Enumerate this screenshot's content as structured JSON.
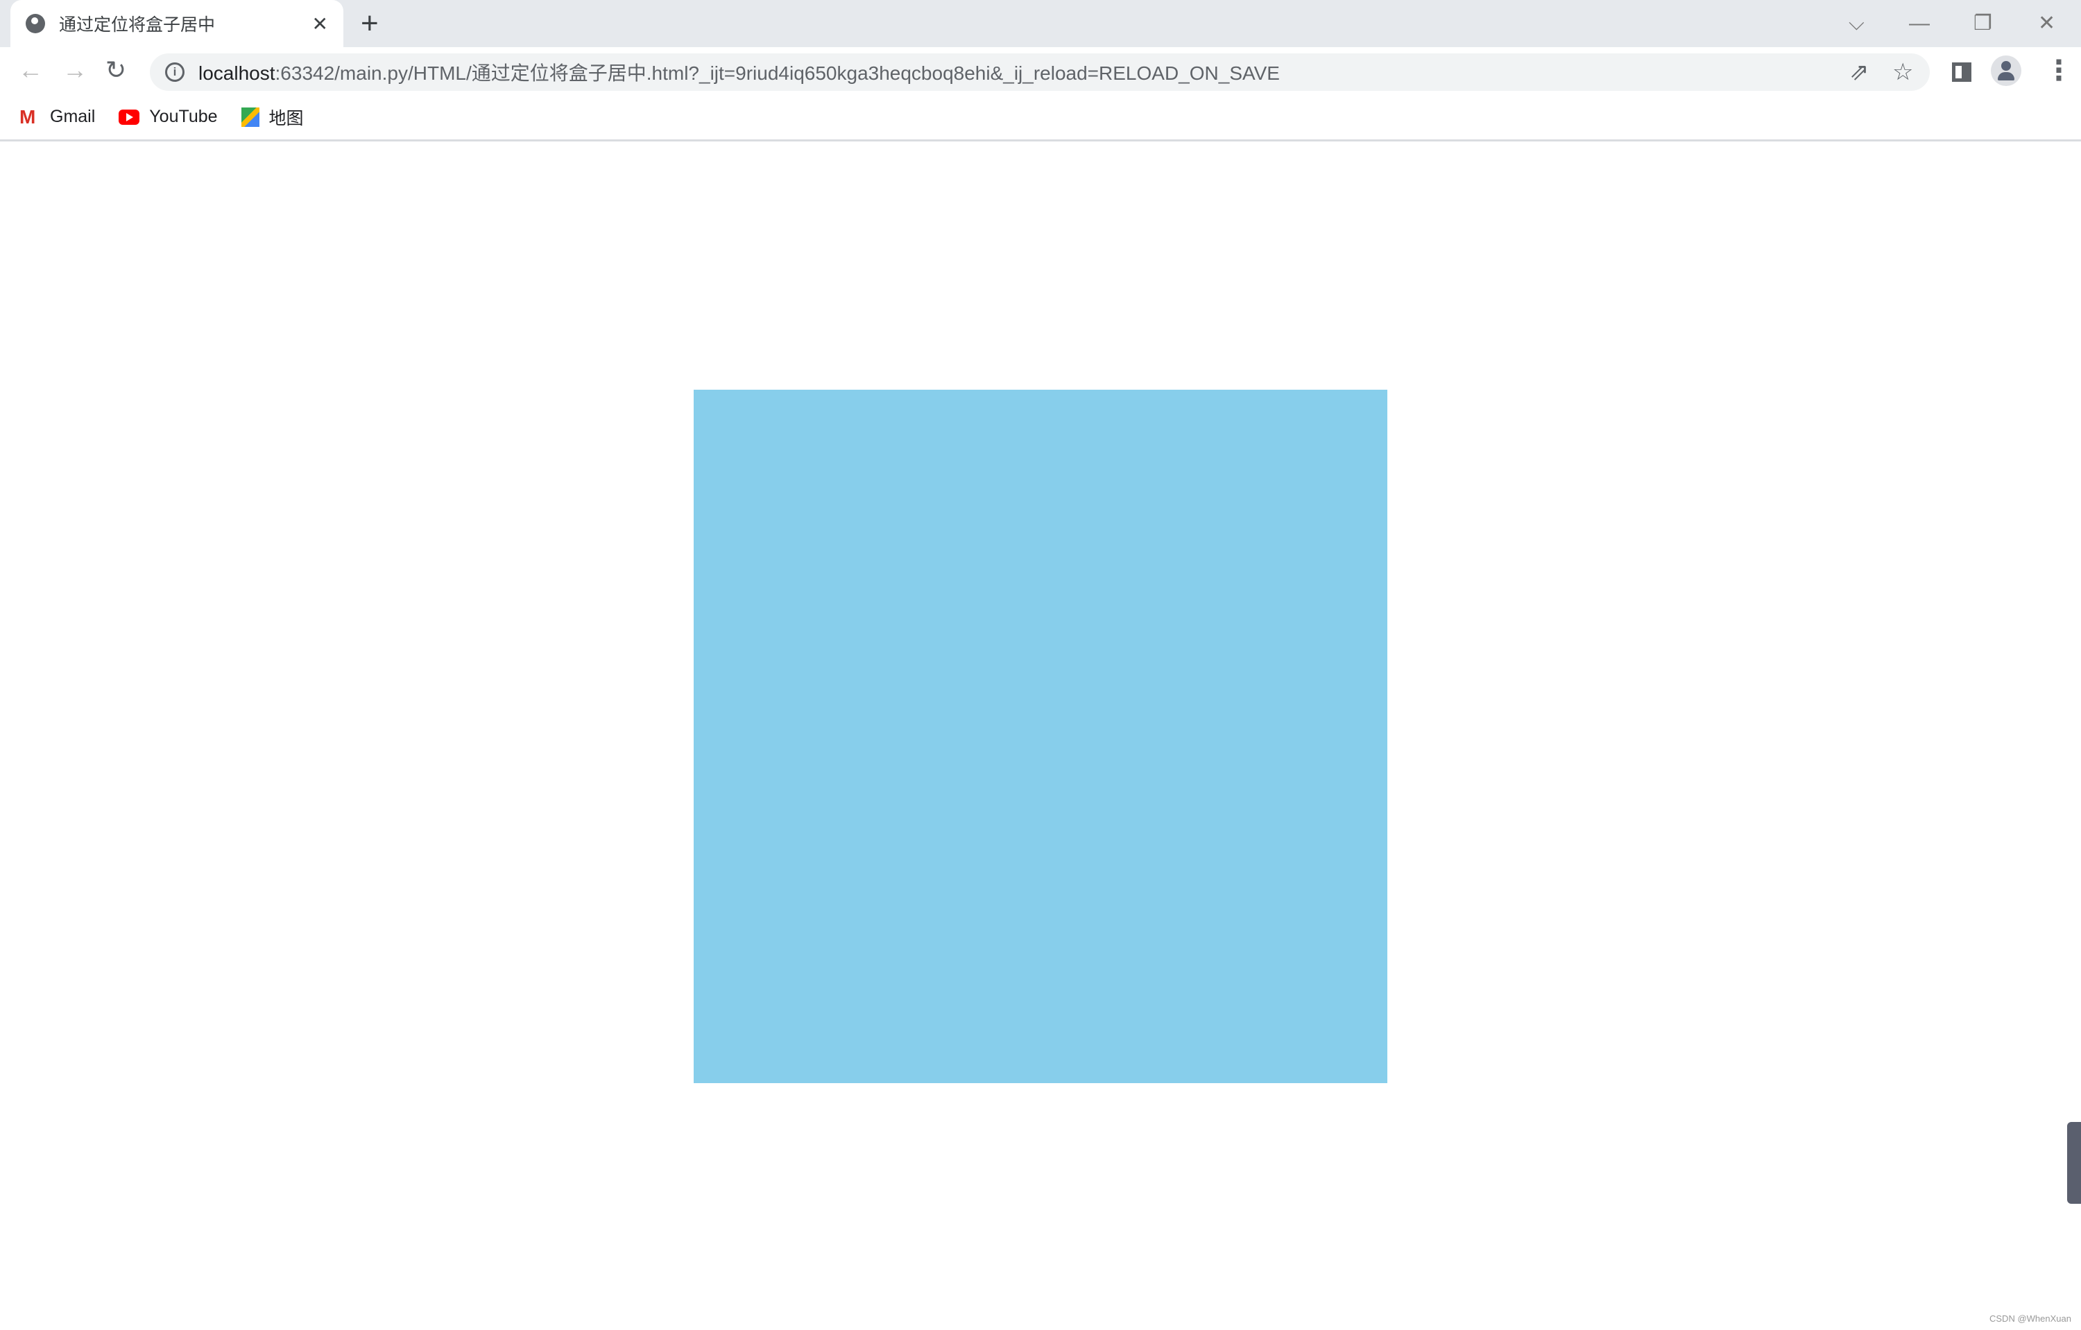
{
  "tab": {
    "title": "通过定位将盒子居中",
    "close": "✕",
    "new_tab": "+",
    "favicon": "globe-icon"
  },
  "window_controls": {
    "list": "⌵",
    "minimize": "—",
    "restore": "❐",
    "close": "✕"
  },
  "toolbar": {
    "back": "←",
    "forward": "→",
    "reload": "↻",
    "url_host": "localhost",
    "url_rest": ":63342/main.py/HTML/通过定位将盒子居中.html?_ijt=9riud4iq650kga3heqcboq8ehi&_ij_reload=RELOAD_ON_SAVE",
    "info": "i",
    "share": "⇗",
    "star": "☆",
    "menu": "⋮"
  },
  "bookmarks": [
    {
      "label": "Gmail",
      "icon": "gmail-icon"
    },
    {
      "label": "YouTube",
      "icon": "youtube-icon"
    },
    {
      "label": "地图",
      "icon": "maps-icon"
    }
  ],
  "page": {
    "box_color": "#87CEEB"
  },
  "watermark": "CSDN @WhenXuan"
}
